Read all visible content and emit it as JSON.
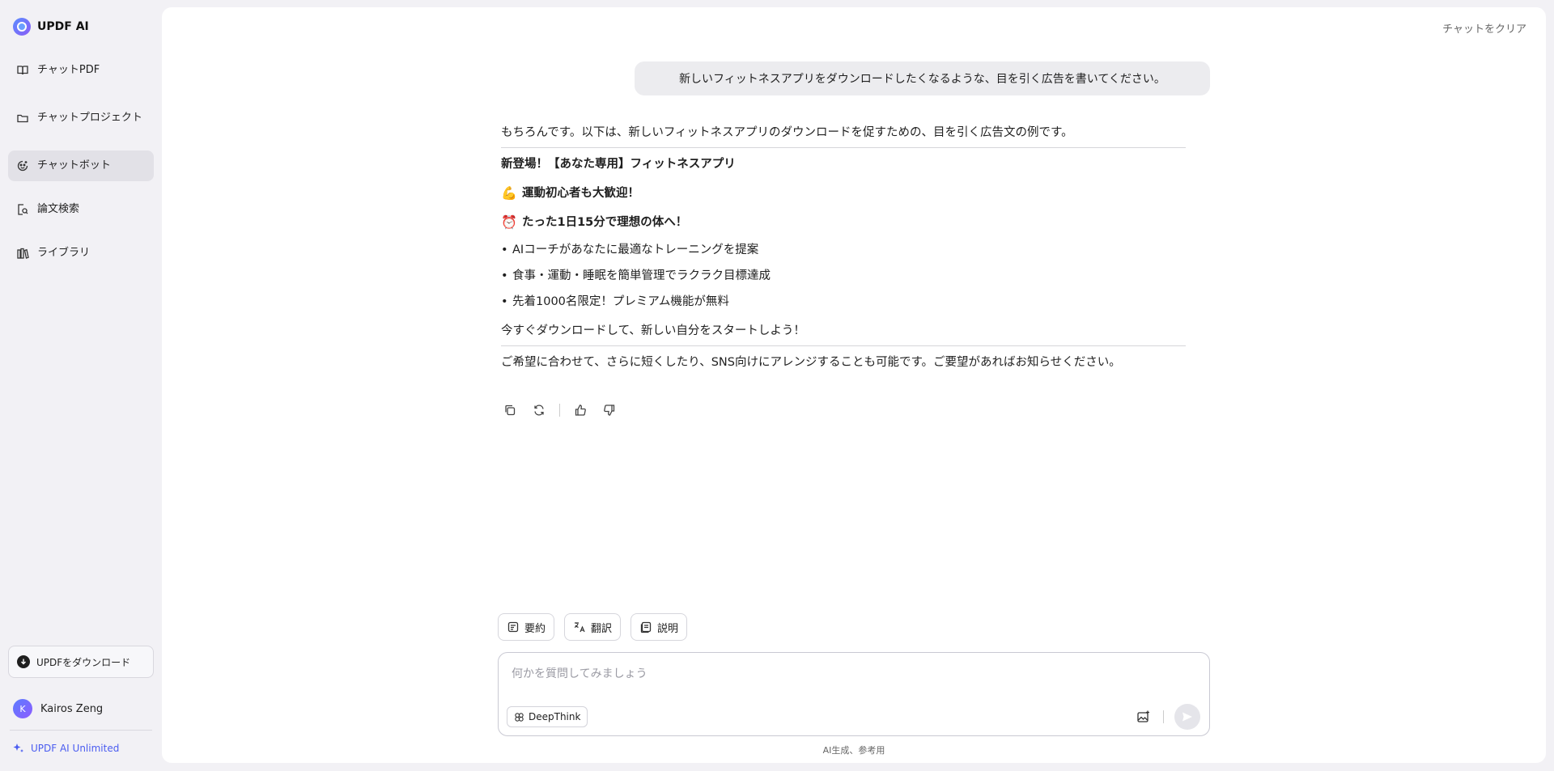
{
  "brand": {
    "name": "UPDF AI"
  },
  "sidebar": {
    "items": [
      {
        "label": "チャットPDF",
        "icon": "book-open-icon"
      },
      {
        "label": "チャットプロジェクト",
        "icon": "folder-icon"
      },
      {
        "label": "チャットボット",
        "icon": "bot-icon",
        "active": true
      },
      {
        "label": "論文検索",
        "icon": "search-document-icon"
      },
      {
        "label": "ライブラリ",
        "icon": "library-icon"
      }
    ],
    "download_label": "UPDFをダウンロード",
    "user_initial": "K",
    "user_name": "Kairos Zeng",
    "unlimited_label": "UPDF AI Unlimited"
  },
  "header": {
    "clear_label": "チャットをクリア"
  },
  "chat": {
    "user_message": "新しいフィットネスアプリをダウンロードしたくなるような、目を引く広告を書いてください。",
    "answer": {
      "intro": "もちろんです。以下は、新しいフィットネスアプリのダウンロードを促すための、目を引く広告文の例です。",
      "title": "新登場！【あなた専用】フィットネスアプリ",
      "heading1_emoji": "💪",
      "heading1": "運動初心者も大歓迎！",
      "heading2_emoji": "⏰",
      "heading2": "たった1日15分で理想の体へ！",
      "bullets": [
        "AIコーチがあなたに最適なトレーニングを提案",
        "食事・運動・睡眠を簡単管理でラクラク目標達成",
        "先着1000名限定！プレミアム機能が無料"
      ],
      "cta": "今すぐダウンロードして、新しい自分をスタートしよう！",
      "outro": "ご希望に合わせて、さらに短くしたり、SNS向けにアレンジすることも可能です。ご要望があればお知らせください。"
    }
  },
  "quick_actions": [
    {
      "label": "要約",
      "icon": "summary-icon"
    },
    {
      "label": "翻訳",
      "icon": "translate-icon"
    },
    {
      "label": "説明",
      "icon": "explain-icon"
    }
  ],
  "composer": {
    "placeholder": "何かを質問してみましょう",
    "value": "",
    "deepthink_label": "DeepThink"
  },
  "footnote": "AI生成、参考用"
}
